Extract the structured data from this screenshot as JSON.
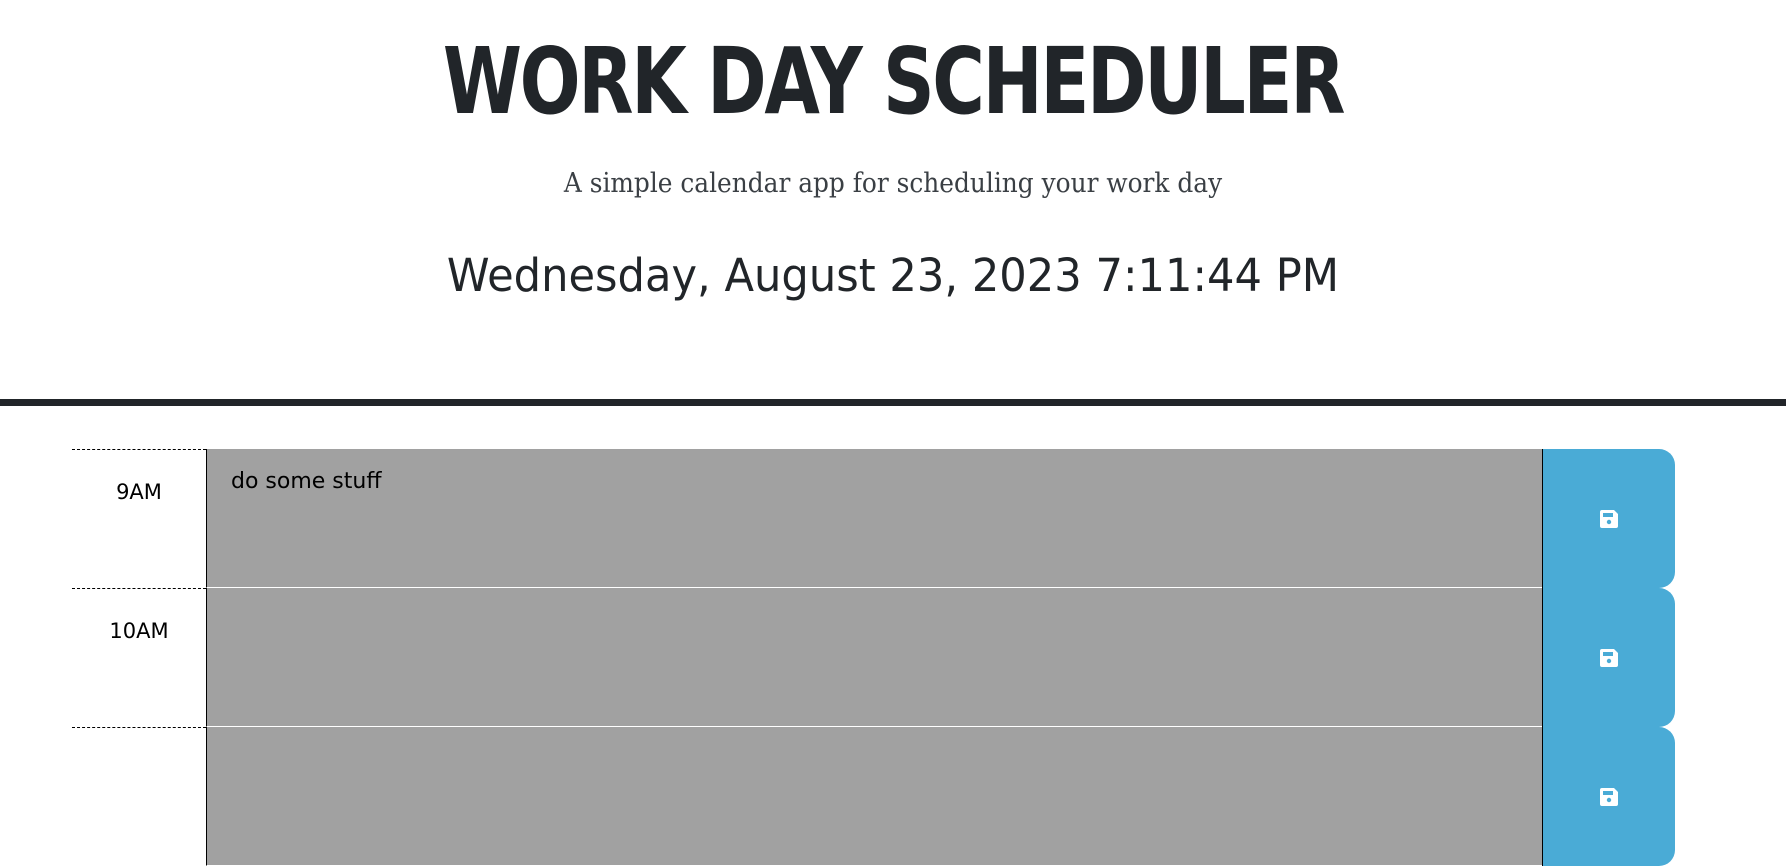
{
  "header": {
    "title": "WORK DAY SCHEDULER",
    "lead": "A simple calendar app for scheduling your work day",
    "current_day": "Wednesday, August 23, 2023 7:11:44 PM"
  },
  "rows": [
    {
      "hour": "9AM",
      "description": "do some stuff",
      "save_icon": "save-icon"
    },
    {
      "hour": "10AM",
      "description": "",
      "save_icon": "save-icon"
    },
    {
      "hour": "",
      "description": "",
      "save_icon": "save-icon"
    }
  ],
  "colors": {
    "past": "#a1a1a1",
    "save_button": "#4aabd6",
    "text": "#212529"
  }
}
